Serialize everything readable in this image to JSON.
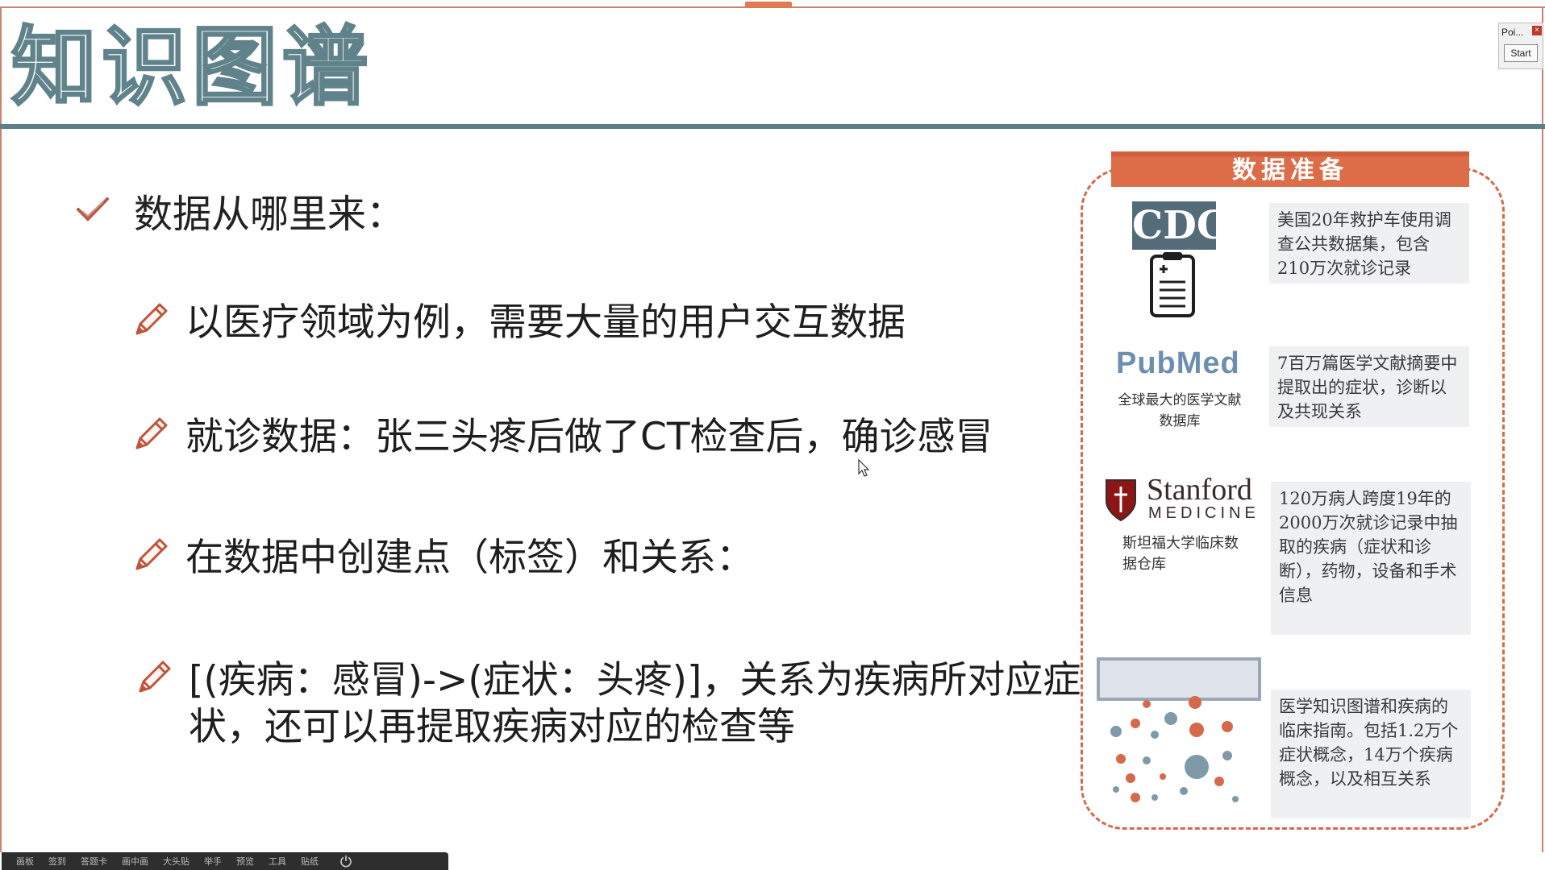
{
  "slide": {
    "title": "知识图谱",
    "main_bullet": "数据从哪里来：",
    "sub_bullets": [
      "以医疗领域为例，需要大量的用户交互数据",
      "就诊数据：张三头疼后做了CT检查后，确诊感冒",
      "在数据中创建点（标签）和关系：",
      "[(疾病：感冒)->(症状：头疼)]，关系为疾病所对应症状，还可以再提取疾病对应的检查等"
    ]
  },
  "panel": {
    "heading": "数据准备",
    "sources": [
      {
        "logo": "CDC",
        "logo_icon": "clipboard-icon",
        "description": "美国20年救护车使用调查公共数据集，包含210万次就诊记录"
      },
      {
        "logo": "PubMed",
        "caption": "全球最大的医学文献数据库",
        "description": "7百万篇医学文献摘要中提取出的症状，诊断以及共现关系"
      },
      {
        "logo": "Stanford",
        "logo_sub": "MEDICINE",
        "caption": "斯坦福大学临床数据仓库",
        "description": "120万病人跨度19年的2000万次就诊记录中抽取的疾病（症状和诊断），药物，设备和手术信息"
      },
      {
        "logo": "",
        "logo_icon": "network-dots-icon",
        "description": "医学知识图谱和疾病的临床指南。包括1.2万个症状概念，14万个疾病概念，以及相互关系"
      }
    ]
  },
  "presenter_widget": {
    "name": "Poi...",
    "start_label": "Start"
  },
  "taskbar": {
    "items": [
      "画板",
      "签到",
      "答题卡",
      "画中画",
      "大头贴",
      "举手",
      "预览",
      "工具",
      "贴纸"
    ]
  },
  "colors": {
    "accent": "#dd6d49",
    "title_stroke": "#60828a",
    "rule": "#5e7f87"
  }
}
